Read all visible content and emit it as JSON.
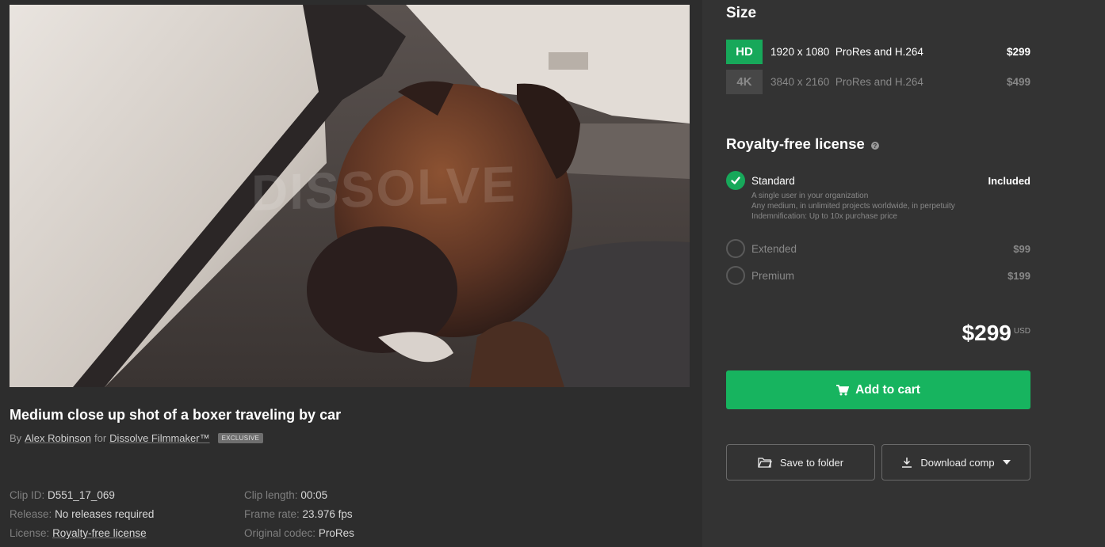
{
  "clip": {
    "title": "Medium close up shot of a boxer traveling by car",
    "by_label": "By",
    "author": "Alex Robinson",
    "for_label": "for",
    "brand": "Dissolve Filmmaker™",
    "badge": "EXCLUSIVE",
    "watermark": "DISSOLVE"
  },
  "meta": {
    "col1": [
      {
        "key": "Clip ID:",
        "value": "D551_17_069"
      },
      {
        "key": "Release:",
        "value": "No releases required"
      },
      {
        "key": "License:",
        "value": "Royalty-free license"
      }
    ],
    "col2": [
      {
        "key": "Clip length:",
        "value": "00:05"
      },
      {
        "key": "Frame rate:",
        "value": "23.976 fps"
      },
      {
        "key": "Original codec:",
        "value": "ProRes"
      }
    ]
  },
  "size": {
    "heading": "Size",
    "options": [
      {
        "tag": "HD",
        "resolution": "1920 x 1080",
        "codec": "ProRes and H.264",
        "price": "$299",
        "selected": true
      },
      {
        "tag": "4K",
        "resolution": "3840 x 2160",
        "codec": "ProRes and H.264",
        "price": "$499",
        "selected": false
      }
    ]
  },
  "license": {
    "heading": "Royalty-free license",
    "help_icon": "question-circle-icon",
    "options": [
      {
        "label": "Standard",
        "price": "Included",
        "selected": true,
        "desc": [
          "A single user in your organization",
          "Any medium, in unlimited projects worldwide, in perpetuity",
          "Indemnification: Up to 10x purchase price"
        ]
      },
      {
        "label": "Extended",
        "price": "$99",
        "selected": false
      },
      {
        "label": "Premium",
        "price": "$199",
        "selected": false
      }
    ]
  },
  "total": {
    "amount": "$299",
    "currency": "USD"
  },
  "actions": {
    "add_to_cart": "Add to cart",
    "save_to_folder": "Save to folder",
    "download_comp": "Download comp"
  },
  "colors": {
    "accent": "#17b45f",
    "panel": "#333333",
    "background": "#2d2d2d"
  }
}
